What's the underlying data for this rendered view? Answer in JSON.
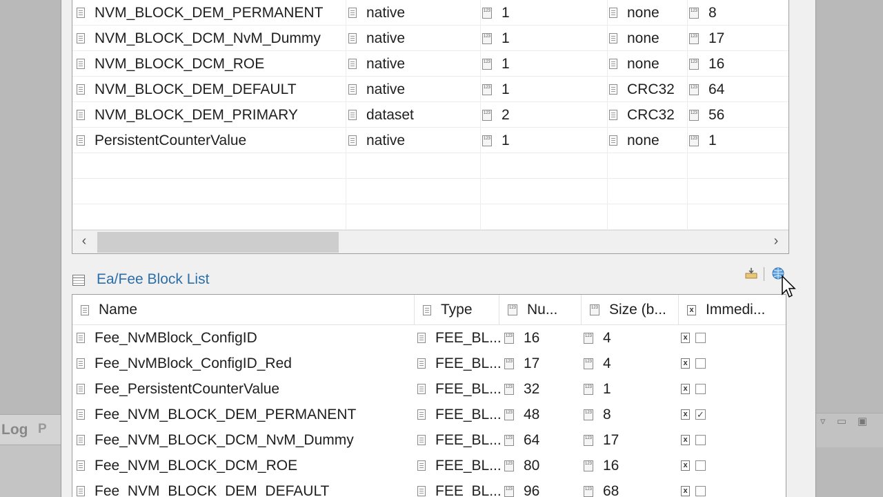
{
  "background": {
    "log_tab": "Log",
    "partial_tab": "P"
  },
  "upper_table": {
    "rows": [
      {
        "name": "NVM_BLOCK_DEM_PERMANENT",
        "mode": "native",
        "count": "1",
        "crc": "none",
        "size": "8"
      },
      {
        "name": "NVM_BLOCK_DCM_NvM_Dummy",
        "mode": "native",
        "count": "1",
        "crc": "none",
        "size": "17"
      },
      {
        "name": "NVM_BLOCK_DCM_ROE",
        "mode": "native",
        "count": "1",
        "crc": "none",
        "size": "16"
      },
      {
        "name": "NVM_BLOCK_DEM_DEFAULT",
        "mode": "native",
        "count": "1",
        "crc": "CRC32",
        "size": "64"
      },
      {
        "name": "NVM_BLOCK_DEM_PRIMARY",
        "mode": "dataset",
        "count": "2",
        "crc": "CRC32",
        "size": "56"
      },
      {
        "name": "PersistentCounterValue",
        "mode": "native",
        "count": "1",
        "crc": "none",
        "size": "1"
      }
    ]
  },
  "section": {
    "title": "Ea/Fee Block List"
  },
  "lower_table": {
    "headers": {
      "name": "Name",
      "type": "Type",
      "number": "Nu...",
      "size": "Size (b...",
      "immediate": "Immedi..."
    },
    "rows": [
      {
        "name": "Fee_NvMBlock_ConfigID",
        "type": "FEE_BL...",
        "number": "16",
        "size": "4",
        "immediate": false
      },
      {
        "name": "Fee_NvMBlock_ConfigID_Red",
        "type": "FEE_BL...",
        "number": "17",
        "size": "4",
        "immediate": false
      },
      {
        "name": "Fee_PersistentCounterValue",
        "type": "FEE_BL...",
        "number": "32",
        "size": "1",
        "immediate": false
      },
      {
        "name": "Fee_NVM_BLOCK_DEM_PERMANENT",
        "type": "FEE_BL...",
        "number": "48",
        "size": "8",
        "immediate": true
      },
      {
        "name": "Fee_NVM_BLOCK_DCM_NvM_Dummy",
        "type": "FEE_BL...",
        "number": "64",
        "size": "17",
        "immediate": false
      },
      {
        "name": "Fee_NVM_BLOCK_DCM_ROE",
        "type": "FEE_BL...",
        "number": "80",
        "size": "16",
        "immediate": false
      },
      {
        "name": "Fee_NVM_BLOCK_DEM_DEFAULT",
        "type": "FEE_BL...",
        "number": "96",
        "size": "68",
        "immediate": false
      }
    ]
  },
  "icons": {
    "row": "document-icon",
    "numeric": "numeric-field-icon",
    "boolean": "boolean-field-icon",
    "import": "import-icon",
    "globe": "globe-icon",
    "cursor": "mouse-pointer-icon"
  },
  "colors": {
    "link_title": "#2b6ea8",
    "panel_bg": "#f0f0f0",
    "table_bg": "#ffffff"
  }
}
